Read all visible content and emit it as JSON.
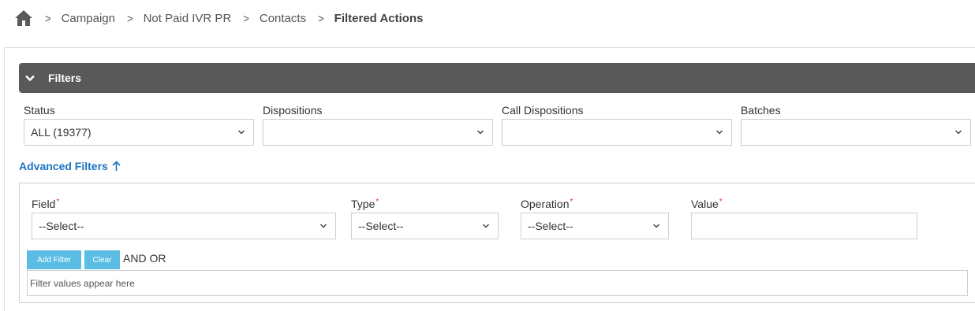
{
  "breadcrumb": {
    "items": [
      "Campaign",
      "Not Paid IVR PR",
      "Contacts"
    ],
    "current": "Filtered Actions"
  },
  "filters": {
    "title": "Filters",
    "status": {
      "label": "Status",
      "value": "ALL (19377)"
    },
    "dispositions": {
      "label": "Dispositions",
      "value": ""
    },
    "call_dispositions": {
      "label": "Call Dispositions",
      "value": ""
    },
    "batches": {
      "label": "Batches",
      "value": ""
    }
  },
  "advanced": {
    "toggle_label": "Advanced Filters",
    "required_marker": "*",
    "field": {
      "label": "Field",
      "value": "--Select--"
    },
    "type": {
      "label": "Type",
      "value": "--Select--"
    },
    "operation": {
      "label": "Operation",
      "value": "--Select--"
    },
    "value": {
      "label": "Value",
      "value": ""
    },
    "add_filter_label": "Add Filter",
    "clear_label": "Clear",
    "and_label": "AND",
    "or_label": "OR",
    "filter_values_text": "Filter values appear here"
  },
  "colors": {
    "header_bg": "#595959",
    "link": "#1a73c2",
    "button": "#5bbce4",
    "required": "#e0352b"
  },
  "icons": {
    "home": "home-icon",
    "separator": "chevron-right-icon",
    "collapse": "chevron-down-icon",
    "advanced_toggle": "arrow-up-icon",
    "select": "chevron-down-icon"
  }
}
